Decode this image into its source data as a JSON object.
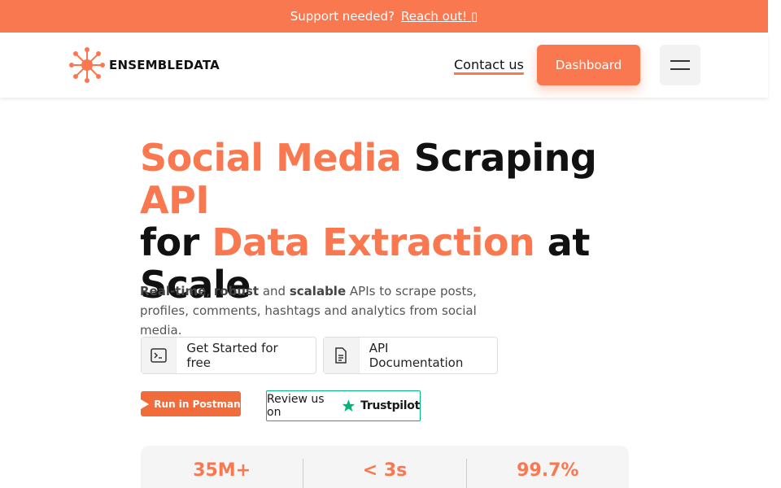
{
  "topbar": {
    "text": "Support needed?",
    "link": "Reach out! ▯"
  },
  "header": {
    "logo_text": "ENSEMBLEDATA",
    "contact_label": "Contact us",
    "dashboard_label": "Dashboard"
  },
  "hero": {
    "title_parts": [
      "Social Media",
      " Scraping ",
      "API",
      "for ",
      "Data Extraction",
      " at",
      "Scale"
    ],
    "subtitle_bold1": "Real-time",
    "subtitle_sep1": ", ",
    "subtitle_bold2": "robust",
    "subtitle_and": " and ",
    "subtitle_bold3": "scalable",
    "subtitle_rest": " APIs to scrape posts, profiles, comments, hashtags and analytics from social media."
  },
  "cta": {
    "start_label": "Get Started for free",
    "docs_label": "API Documentation"
  },
  "badges": {
    "postman_label": "Run in Postman",
    "trustpilot_prefix": "Review us on",
    "trustpilot_brand": "Trustpilot"
  },
  "stats": [
    "35M+",
    "< 3s",
    "99.7%"
  ],
  "colors": {
    "accent": "#f97850",
    "trustpilot_green": "#00b67a"
  }
}
